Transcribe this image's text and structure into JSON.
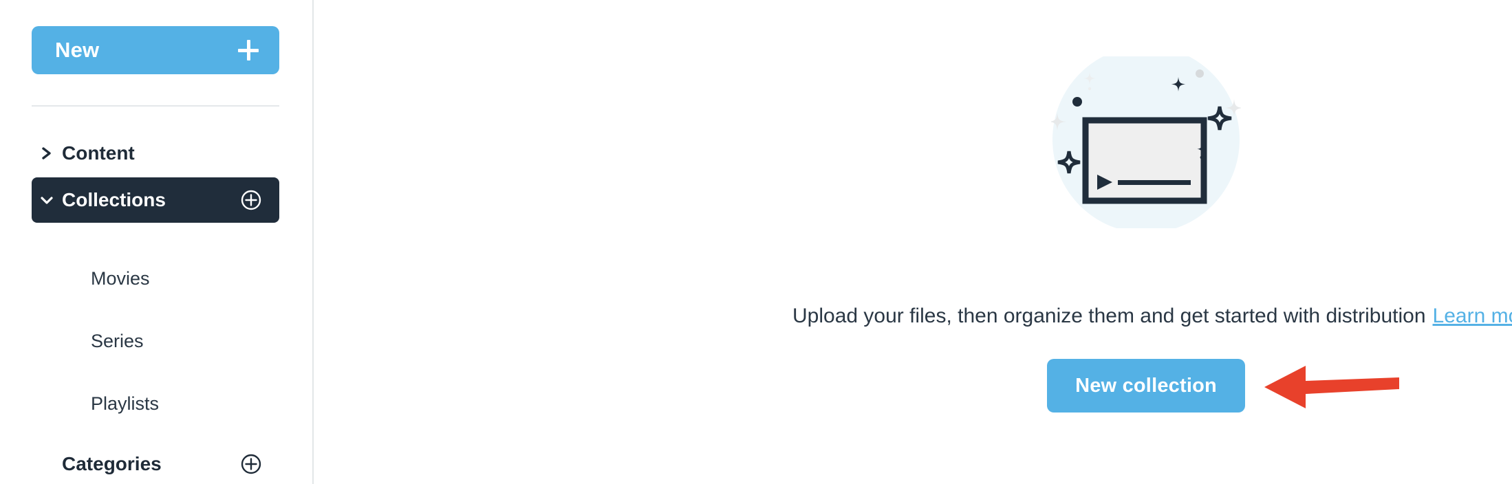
{
  "theme": {
    "accent_blue": "#54b1e5",
    "selected_navy": "#202d3b",
    "text_dark": "#2a3744",
    "illustration_circle": "#edf6fa",
    "illustration_stroke": "#202d3b",
    "illustration_screen": "#efefef",
    "annotation_red": "#e8412b",
    "divider_gray": "#e4e8ea"
  },
  "sidebar": {
    "new_button": {
      "label": "New",
      "icon": "plus-icon"
    },
    "nav": [
      {
        "id": "content",
        "label": "Content",
        "chevron": "chevron-right-icon",
        "expanded": false,
        "selected": false,
        "has_add_button": false
      },
      {
        "id": "collections",
        "label": "Collections",
        "chevron": "chevron-down-icon",
        "expanded": true,
        "selected": true,
        "has_add_button": true,
        "add_icon": "plus-circle-icon"
      },
      {
        "id": "categories",
        "label": "Categories",
        "chevron": "",
        "expanded": false,
        "selected": false,
        "has_add_button": true,
        "add_icon": "plus-circle-icon"
      }
    ],
    "collection_items": [
      {
        "id": "movies",
        "label": "Movies"
      },
      {
        "id": "series",
        "label": "Series"
      },
      {
        "id": "playlists",
        "label": "Playlists"
      }
    ]
  },
  "main": {
    "empty_state": {
      "illustration": "video-player-sparkles-illustration",
      "message": "Upload your files, then organize them and get started with distribution",
      "learn_more_label": "Learn more",
      "primary_button_label": "New collection"
    },
    "annotation": {
      "shape": "left-pointing-arrow",
      "color": "#e8412b",
      "points_at": "New collection"
    }
  }
}
